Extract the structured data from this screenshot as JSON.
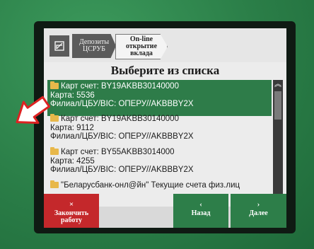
{
  "breadcrumb": {
    "step1": "Депозиты\nЦСРУБ",
    "step2": "On-line\nоткрытие\nвклада"
  },
  "title": "Выберите из списка",
  "list": [
    {
      "line1": "Карт счет: BY19AKBB30140000",
      "line2": "Карта: 5536",
      "line3": "Филиал/ЦБУ/BIC: ОПЕРУ//AKBBBY2X",
      "selected": true
    },
    {
      "line1": "Карт счет: BY19AKBB30140000",
      "line2": "Карта: 9112",
      "line3": "Филиал/ЦБУ/BIC: ОПЕРУ//AKBBBY2X",
      "selected": false
    },
    {
      "line1": "Карт счет: BY55AKBB3014000",
      "line2": "Карта: 4255",
      "line3": "Филиал/ЦБУ/BIC: ОПЕРУ//AKBBBY2X",
      "selected": false
    },
    {
      "line1": "\"Беларусбанк-онл@йн\" Текущие счета физ.лиц",
      "selected": false
    }
  ],
  "buttons": {
    "finish_symbol": "×",
    "finish_label": "Закончить\nработу",
    "back_symbol": "‹",
    "back_label": "Назад",
    "next_symbol": "›",
    "next_label": "Далее"
  },
  "icons": {
    "home": "home-icon",
    "folder": "folder-icon",
    "scroll_up": "chevron-up-icon",
    "scroll_down": "chevron-down-icon"
  },
  "colors": {
    "kiosk_green": "#2f8a4f",
    "selected_row": "#2e7c49",
    "finish_red": "#c4282b",
    "nav_green": "#2d7e49"
  }
}
